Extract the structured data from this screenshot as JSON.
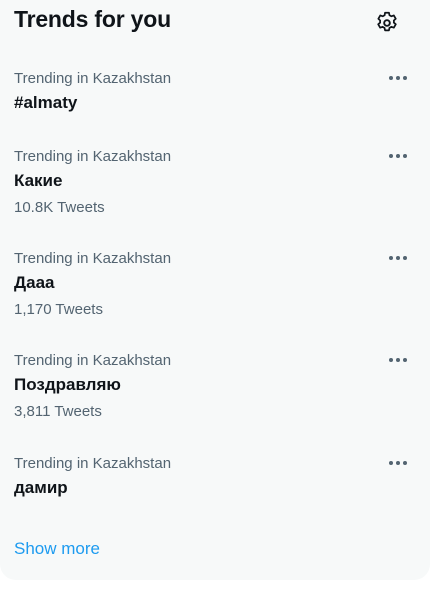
{
  "title": "Trends for you",
  "icons": {
    "settings": "gear-icon",
    "more": "more-horizontal-icon"
  },
  "colors": {
    "panel_bg": "#f7f9f9",
    "primary_text": "#0f1419",
    "secondary_text": "#536471",
    "link": "#1d9bf0"
  },
  "trends": [
    {
      "context": "Trending in Kazakhstan",
      "name": "#almaty",
      "count": ""
    },
    {
      "context": "Trending in Kazakhstan",
      "name": "Какие",
      "count": "10.8K Tweets"
    },
    {
      "context": "Trending in Kazakhstan",
      "name": "Дааа",
      "count": "1,170 Tweets"
    },
    {
      "context": "Trending in Kazakhstan",
      "name": "Поздравляю",
      "count": "3,811 Tweets"
    },
    {
      "context": "Trending in Kazakhstan",
      "name": "дамир",
      "count": ""
    }
  ],
  "show_more": "Show more"
}
